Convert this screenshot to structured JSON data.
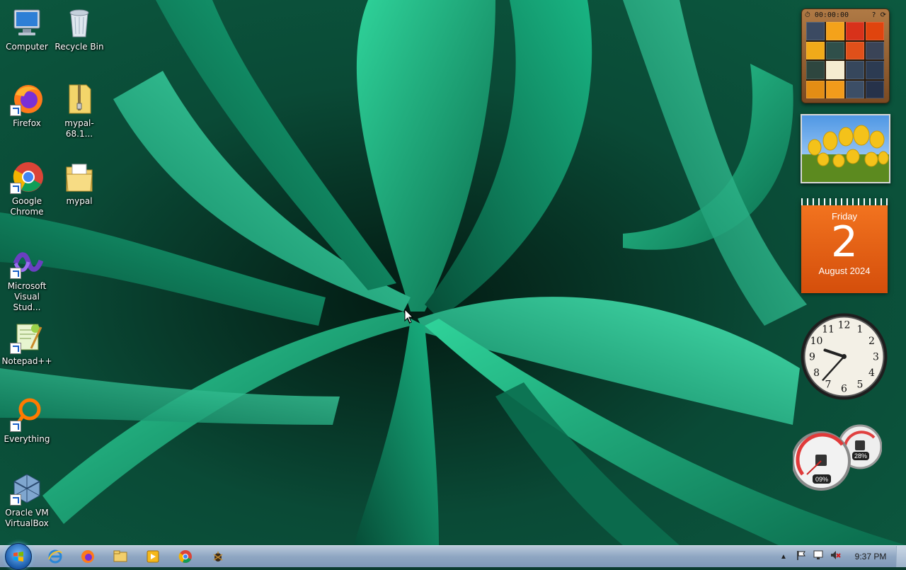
{
  "desktop": {
    "icons": [
      {
        "label": "Computer",
        "icon": "computer-icon"
      },
      {
        "label": "Recycle Bin",
        "icon": "recycle-bin-icon"
      },
      {
        "label": "Firefox",
        "icon": "firefox-icon"
      },
      {
        "label": "mypal-68.1...",
        "icon": "zip-folder-icon"
      },
      {
        "label": "Google Chrome",
        "icon": "chrome-icon"
      },
      {
        "label": "mypal",
        "icon": "folder-icon"
      },
      {
        "label": "Microsoft Visual Stud...",
        "icon": "visual-studio-icon"
      },
      {
        "label": "Notepad++",
        "icon": "notepadpp-icon"
      },
      {
        "label": "Everything",
        "icon": "everything-search-icon"
      },
      {
        "label": "Oracle VM VirtualBox",
        "icon": "virtualbox-icon"
      }
    ]
  },
  "gadgets": {
    "puzzle": {
      "timer": "00:00:00"
    },
    "calendar": {
      "weekday": "Friday",
      "day": "2",
      "month_year": "August 2024"
    },
    "clock": {
      "numbers": [
        "12",
        "1",
        "2",
        "3",
        "4",
        "5",
        "6",
        "7",
        "8",
        "9",
        "10",
        "11"
      ],
      "hour": 9,
      "minute": 37
    },
    "cpu_meter": {
      "cpu": "09%",
      "memory": "28%"
    }
  },
  "taskbar": {
    "pinned": [
      "internet-explorer-icon",
      "firefox-icon",
      "explorer-folder-icon",
      "media-player-icon",
      "chrome-icon",
      "bug-app-icon"
    ],
    "tray": [
      "show-hidden-icons-chevron",
      "action-center-flag-icon",
      "network-icon",
      "volume-muted-icon"
    ],
    "time": "9:37 PM"
  },
  "colors": {
    "calendar_orange": "#e8601a",
    "taskbar": "#9fb3cc",
    "accent_green": "#0f8a5f"
  }
}
